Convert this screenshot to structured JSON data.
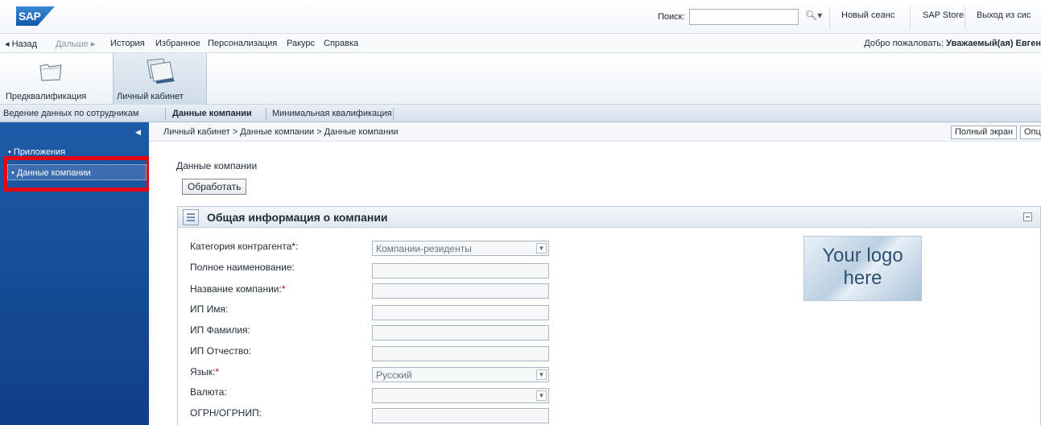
{
  "header": {
    "logo_text": "SAP",
    "search_label": "Поиск:",
    "search_value": "",
    "links": [
      "Новый сеанс",
      "SAP Store",
      "Выход из сис"
    ]
  },
  "nav": {
    "back": "◂ Назад",
    "forward": "Дальше ▸",
    "items": [
      "История",
      "Избранное",
      "Персонализация",
      "Ракурс",
      "Справка"
    ],
    "welcome_prefix": "Добро пожаловать:",
    "welcome_user": "Уважаемый(ая) Евген"
  },
  "workcenters": [
    {
      "label": "Предквалификация",
      "icon": "folder-icon"
    },
    {
      "label": "Личный кабинет",
      "icon": "documents-icon"
    }
  ],
  "subtabs": [
    "Ведение данных по сотрудникам",
    "Данные компании",
    "Минимальная квалификация"
  ],
  "sidebar": {
    "items": [
      "• Приложения",
      "• Данные компании"
    ]
  },
  "breadcrumb": "Личный кабинет  >  Данные компании  >  Данные компании",
  "toolbar": {
    "fullscreen": "Полный экран",
    "options": "Опц"
  },
  "page": {
    "title": "Данные компании",
    "process_button": "Обработать"
  },
  "panel": {
    "title": "Общая информация о компании",
    "logo_line1": "Your logo",
    "logo_line2": "here",
    "fields": [
      {
        "label": "Категория контрагента*:",
        "value": "Компании-резиденты",
        "type": "select"
      },
      {
        "label": "Полное наименование:",
        "value": "",
        "type": "text"
      },
      {
        "label": "Название компании:",
        "required": "*",
        "value": "",
        "type": "text"
      },
      {
        "label": "ИП Имя:",
        "value": "",
        "type": "text"
      },
      {
        "label": "ИП Фамилия:",
        "value": "",
        "type": "text"
      },
      {
        "label": "ИП Отчество:",
        "value": "",
        "type": "text"
      },
      {
        "label": "Язык:",
        "required": "*",
        "value": "Русский",
        "type": "select"
      },
      {
        "label": "Валюта:",
        "value": "",
        "type": "select"
      },
      {
        "label": "ОГРН/ОГРНИП:",
        "value": "",
        "type": "text"
      }
    ]
  },
  "colors": {
    "sidebar": "#1e5ba8",
    "highlight": "#e30613",
    "required": "#d00000"
  }
}
